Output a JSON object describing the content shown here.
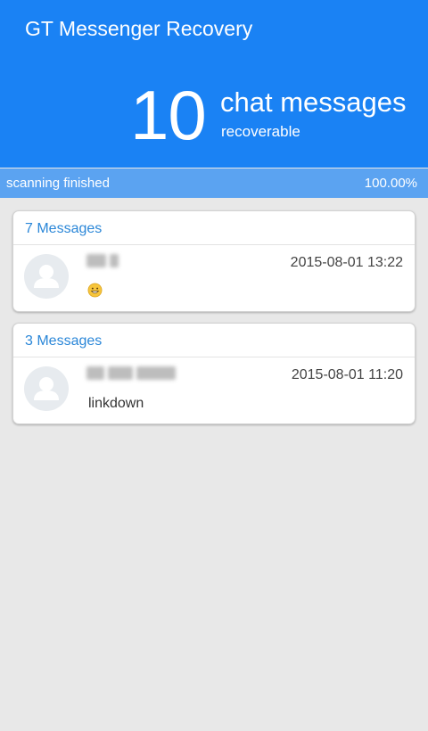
{
  "app": {
    "title": "GT Messenger Recovery"
  },
  "summary": {
    "count": "10",
    "label": "chat messages",
    "sublabel": "recoverable"
  },
  "progress": {
    "status": "scanning finished",
    "percent_text": "100.00%",
    "fraction": 1.0
  },
  "colors": {
    "header_blue": "#1a82f4",
    "progress_track": "#a9c9ee",
    "progress_fill": "#5ba3f1",
    "accent_text": "#2b87d8",
    "background": "#e8e8e8"
  },
  "conversations": [
    {
      "header": "7 Messages",
      "sender_redacted": true,
      "timestamp": "2015-08-01 13:22",
      "preview": "",
      "preview_icon": "grinning-emoji-icon",
      "avatar_icon": "person-avatar-icon"
    },
    {
      "header": "3 Messages",
      "sender_redacted": true,
      "timestamp": "2015-08-01 11:20",
      "preview": "linkdown",
      "avatar_icon": "person-avatar-icon"
    }
  ]
}
